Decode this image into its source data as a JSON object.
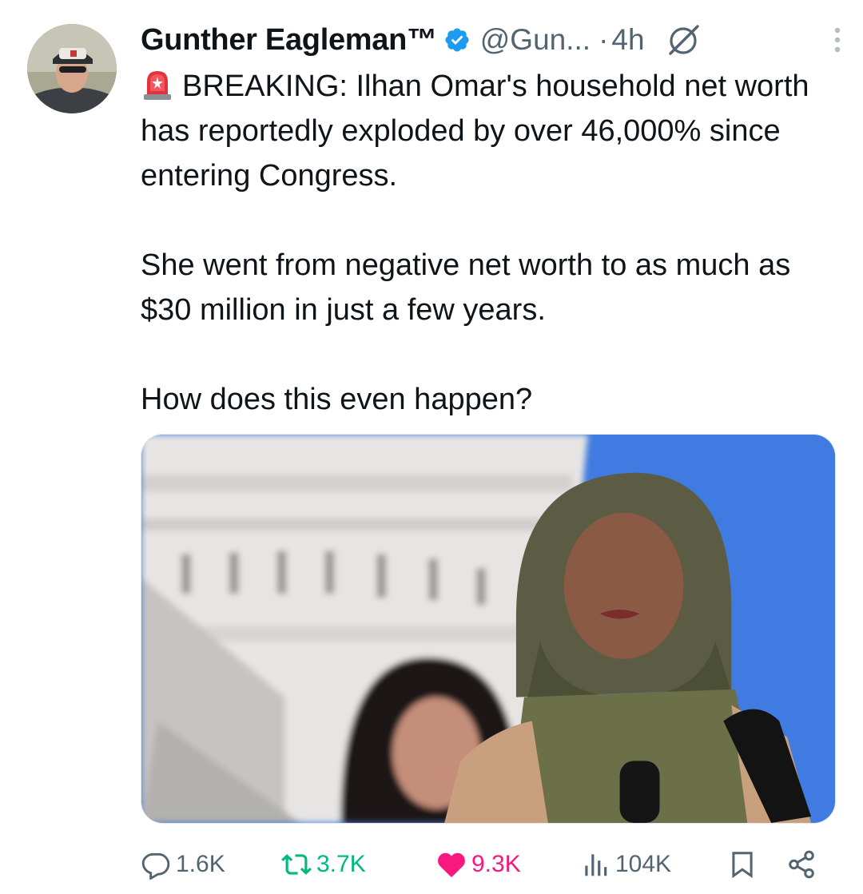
{
  "author": {
    "name": "Gunther Eagleman™",
    "handle": "@Gun...",
    "separator": "·",
    "time": "4h"
  },
  "icons": {
    "avatar": "profile-photo",
    "verified": "verified-badge-icon",
    "grok": "grok-icon",
    "more": "more-options-icon",
    "siren": "police-light-emoji"
  },
  "tweet": {
    "paragraph_1": "BREAKING: Ilhan Omar's household net worth has reportedly exploded by over 46,000% since entering Congress.",
    "paragraph_2": "She went from negative net worth to as much as $30 million in just a few years.",
    "paragraph_3": "How does this even happen?"
  },
  "actions": {
    "replies": "1.6K",
    "retweets": "3.7K",
    "likes": "9.3K",
    "views": "104K"
  },
  "colors": {
    "text": "#0f1419",
    "secondary": "#536471",
    "verified": "#1d9bf0",
    "retweet": "#00ba7c",
    "like": "#f91880"
  }
}
